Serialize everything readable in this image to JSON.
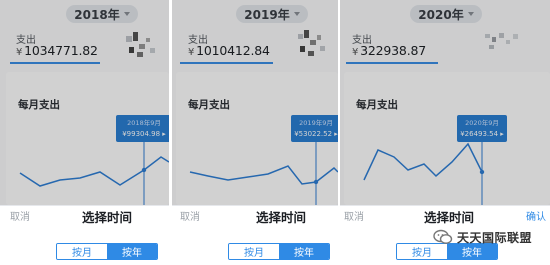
{
  "panels": [
    {
      "year_label": "2018年",
      "spend_label": "支出",
      "currency": "¥",
      "total": "1034771.82",
      "card_title": "每月支出",
      "tooltip_title": "2018年9月",
      "tooltip_value": "¥99304.98 ▸",
      "cancel_label": "取消",
      "sheet_title": "选择时间",
      "toggle_month": "按月",
      "toggle_year": "按年",
      "selected_toggle": "按年",
      "chart_data": {
        "type": "line",
        "values_visible": [
          "visible",
          "visible"
        ],
        "selected_point": "2018年9月",
        "selected_value": 99304.98
      }
    },
    {
      "year_label": "2019年",
      "spend_label": "支出",
      "currency": "¥",
      "total": "1010412.84",
      "card_title": "每月支出",
      "tooltip_title": "2019年9月",
      "tooltip_value": "¥53022.52 ▸",
      "cancel_label": "取消",
      "sheet_title": "选择时间",
      "toggle_month": "按月",
      "toggle_year": "按年",
      "selected_toggle": "按年",
      "chart_data": {
        "type": "line",
        "selected_point": "2019年9月",
        "selected_value": 53022.52
      }
    },
    {
      "year_label": "2020年",
      "spend_label": "支出",
      "currency": "¥",
      "total": "322938.87",
      "card_title": "每月支出",
      "tooltip_title": "2020年9月",
      "tooltip_value": "¥26493.54 ▸",
      "cancel_label": "取消",
      "confirm_label": "确认",
      "sheet_title": "选择时间",
      "toggle_month": "按月",
      "toggle_year": "按年",
      "selected_toggle": "按年",
      "chart_data": {
        "type": "line",
        "selected_point": "2020年9月",
        "selected_value": 26493.54
      }
    }
  ],
  "watermark": "天天国际联盟",
  "colors": {
    "accent": "#2f8ae5",
    "line": "#2f7fd6",
    "tooltip_bg": "#2a7fd4"
  }
}
